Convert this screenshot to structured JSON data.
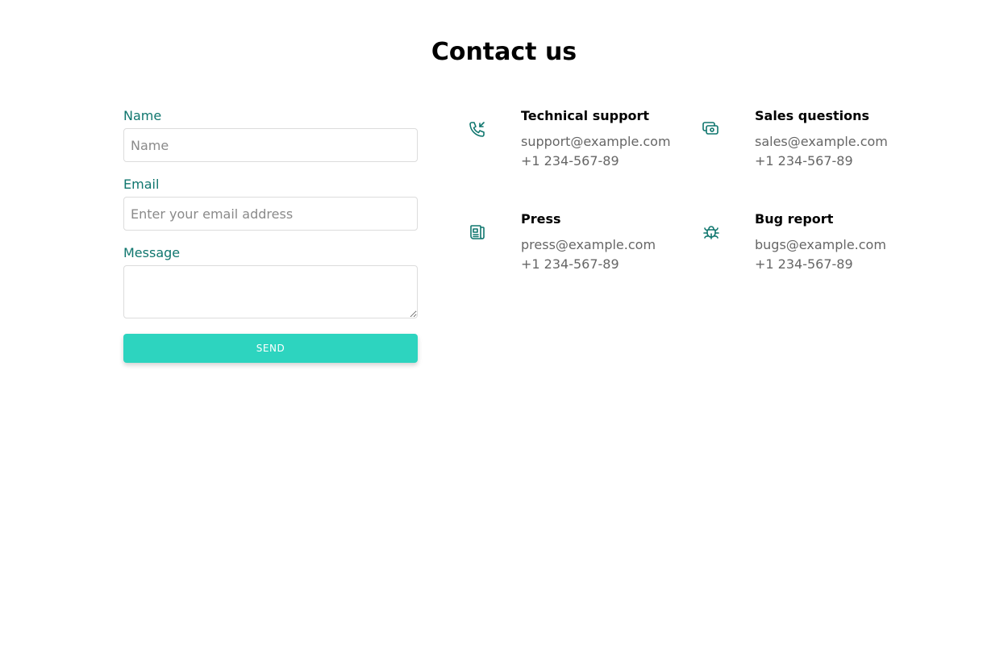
{
  "page": {
    "title": "Contact us"
  },
  "form": {
    "name_label": "Name",
    "name_placeholder": "Name",
    "name_value": "",
    "email_label": "Email",
    "email_placeholder": "Enter your email address",
    "email_value": "",
    "message_label": "Message",
    "message_value": "",
    "send_label": "SEND"
  },
  "contacts": [
    {
      "icon": "phone-incoming-icon",
      "title": "Technical support",
      "email": "support@example.com",
      "phone": "+1 234-567-89"
    },
    {
      "icon": "cash-icon",
      "title": "Sales questions",
      "email": "sales@example.com",
      "phone": "+1 234-567-89"
    },
    {
      "icon": "newspaper-icon",
      "title": "Press",
      "email": "press@example.com",
      "phone": "+1 234-567-89"
    },
    {
      "icon": "bug-icon",
      "title": "Bug report",
      "email": "bugs@example.com",
      "phone": "+1 234-567-89"
    }
  ],
  "colors": {
    "accent": "#2dd4bf",
    "label": "#0f766e",
    "icon": "#0f766e",
    "muted_text": "#666666"
  }
}
